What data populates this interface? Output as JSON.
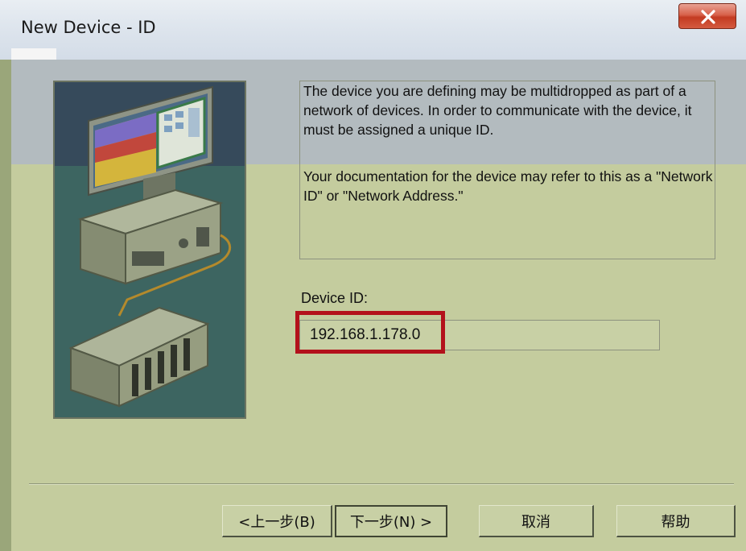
{
  "window": {
    "title": "New Device - ID",
    "close_glyph": "x"
  },
  "description": {
    "paragraph1": "The device you are defining may be multidropped as part of a network of devices.  In order to communicate with the device, it must be assigned a unique ID.",
    "paragraph2": "Your documentation for the device may refer to this as a \"Network ID\" or \"Network Address.\""
  },
  "device_id": {
    "label": "Device ID:",
    "value": "192.168.1.178.0"
  },
  "buttons": {
    "back": "<上一步(B)",
    "next": "下一步(N) >",
    "cancel": "取消",
    "help": "帮助"
  },
  "icons": {
    "close": "close-icon",
    "illustration": "computer-plc-illustration"
  },
  "colors": {
    "background": "#c4cc9e",
    "highlight": "#b3111b",
    "close_button": "#c9442b"
  }
}
